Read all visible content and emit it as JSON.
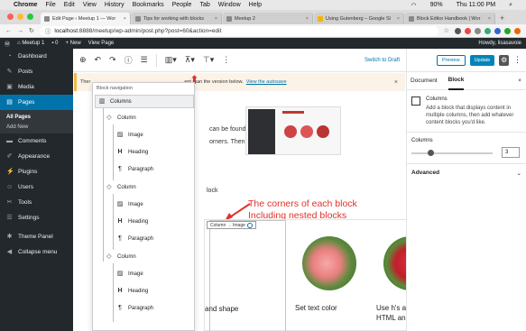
{
  "macbar": {
    "app": "Chrome",
    "menus": [
      "File",
      "Edit",
      "View",
      "History",
      "Bookmarks",
      "People",
      "Tab",
      "Window",
      "Help"
    ],
    "battery": "90%",
    "clock": "Thu 11:00 PM"
  },
  "tabs": [
    {
      "title": "Edit Page ‹ Meetup 1 — Wor"
    },
    {
      "title": "Tips for working with blocks"
    },
    {
      "title": "Meetup 2"
    },
    {
      "title": "Using Gutenberg – Google Sl"
    },
    {
      "title": "Block Editor Handbook | Wor"
    }
  ],
  "address": {
    "url": "localhost:8888/meetup/wp-admin/post.php?post=60&action=edit",
    "host": "localhost",
    "rest": ":8888/meetup/wp-admin/post.php?post=60&action=edit"
  },
  "adminbar": {
    "site": "Meetup 1",
    "comments": "0",
    "new": "+ New",
    "view": "View Page",
    "howdy": "Howdy, lisasavoie"
  },
  "sidebar": {
    "items": [
      {
        "label": "Dashboard",
        "icon": "dashboard-icon"
      },
      {
        "label": "Posts",
        "icon": "pin-icon"
      },
      {
        "label": "Media",
        "icon": "media-icon"
      },
      {
        "label": "Pages",
        "icon": "pages-icon"
      },
      {
        "label": "Comments",
        "icon": "comments-icon"
      },
      {
        "label": "Appearance",
        "icon": "appearance-icon"
      },
      {
        "label": "Plugins",
        "icon": "plugins-icon"
      },
      {
        "label": "Users",
        "icon": "users-icon"
      },
      {
        "label": "Tools",
        "icon": "tools-icon"
      },
      {
        "label": "Settings",
        "icon": "settings-icon"
      },
      {
        "label": "Theme Panel",
        "icon": "theme-panel-icon"
      },
      {
        "label": "Collapse menu",
        "icon": "collapse-icon"
      }
    ],
    "sub": [
      "All Pages",
      "Add New"
    ]
  },
  "toolbar": {
    "switch": "Switch to Draft"
  },
  "notice": {
    "prefix": "Ther",
    "text": "ent than the version below.",
    "link": "View the autosave"
  },
  "content": {
    "line1": "can be found",
    "line2": "orners. Then",
    "line3": "lock"
  },
  "annotation": {
    "line1": "The corners of each block",
    "line2": "Including nested blocks"
  },
  "breadcrumb": {
    "label": "Column → Image"
  },
  "columns": [
    {
      "text": "and shape"
    },
    {
      "text": "Set text color"
    },
    {
      "text": "Use h's as an",
      "text2": "HTML anchor"
    }
  ],
  "nav": {
    "title": "Block navigation",
    "rows": [
      "Columns",
      "Column",
      "Image",
      "Heading",
      "Paragraph",
      "Column",
      "Image",
      "Heading",
      "Paragraph",
      "Column",
      "Image",
      "Heading",
      "Paragraph"
    ]
  },
  "right": {
    "preview": "Preview",
    "update": "Update",
    "tab_document": "Document",
    "tab_block": "Block",
    "block_name": "Columns",
    "block_desc": "Add a block that displays content in multiple columns, then add whatever content blocks you'd like.",
    "columns_label": "Columns",
    "columns_value": "3",
    "advanced": "Advanced"
  }
}
